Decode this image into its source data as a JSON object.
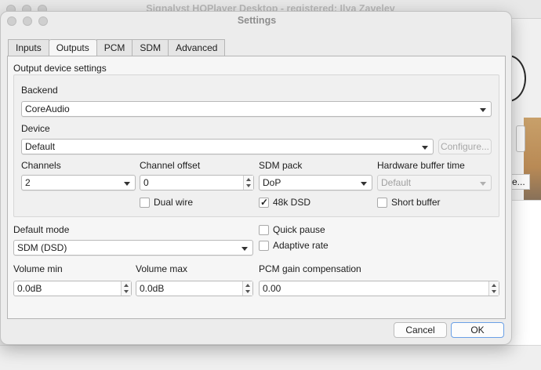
{
  "main_window": {
    "title": "Signalyst HQPlayer Desktop - registered: Ilya Zavelev",
    "partial_button_label": "e..."
  },
  "dialog": {
    "title": "Settings",
    "tabs": [
      {
        "label": "Inputs",
        "active": false
      },
      {
        "label": "Outputs",
        "active": true
      },
      {
        "label": "PCM",
        "active": false
      },
      {
        "label": "SDM",
        "active": false
      },
      {
        "label": "Advanced",
        "active": false
      }
    ],
    "section_title": "Output device settings",
    "backend": {
      "label": "Backend",
      "value": "CoreAudio"
    },
    "device": {
      "label": "Device",
      "value": "Default",
      "configure_label": "Configure..."
    },
    "channels": {
      "label": "Channels",
      "value": "2"
    },
    "channel_offset": {
      "label": "Channel offset",
      "value": "0"
    },
    "sdm_pack": {
      "label": "SDM pack",
      "value": "DoP"
    },
    "hardware_buffer_time": {
      "label": "Hardware buffer time",
      "value": "Default"
    },
    "dual_wire": {
      "label": "Dual wire",
      "checked": false
    },
    "dsd_48k": {
      "label": "48k DSD",
      "checked": true
    },
    "short_buffer": {
      "label": "Short buffer",
      "checked": false
    },
    "default_mode": {
      "label": "Default mode",
      "value": "SDM (DSD)"
    },
    "quick_pause": {
      "label": "Quick pause",
      "checked": false
    },
    "adaptive_rate": {
      "label": "Adaptive rate",
      "checked": false
    },
    "volume_min": {
      "label": "Volume min",
      "value": "0.0dB"
    },
    "volume_max": {
      "label": "Volume max",
      "value": "0.0dB"
    },
    "pcm_gain_compensation": {
      "label": "PCM gain compensation",
      "value": "0.00"
    },
    "cancel_label": "Cancel",
    "ok_label": "OK"
  }
}
